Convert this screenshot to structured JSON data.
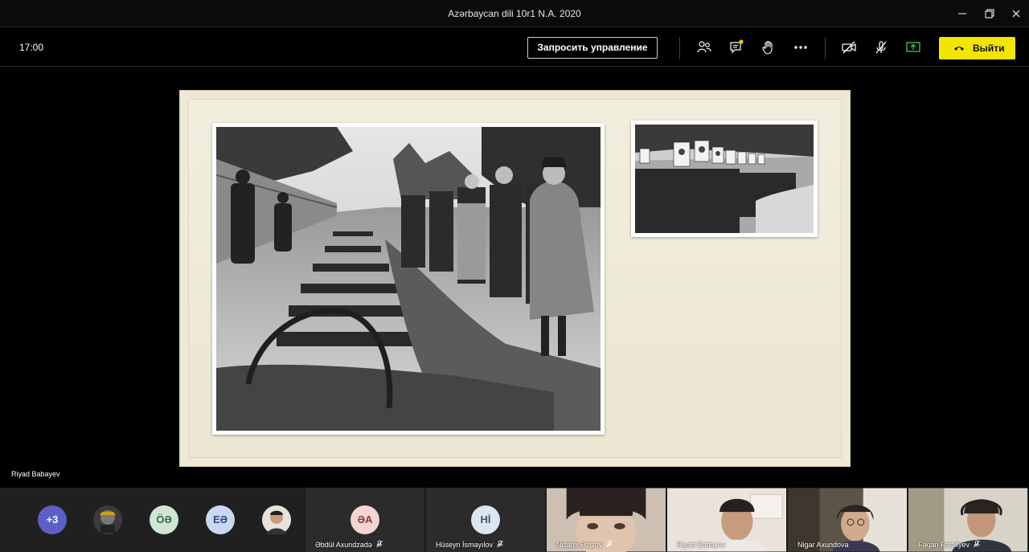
{
  "window": {
    "title": "Azərbaycan dili 10r1 N.A. 2020"
  },
  "toolbar": {
    "time": "17:00",
    "request_control_label": "Запросить управление",
    "leave_label": "Выйти",
    "icons": [
      "participants-icon",
      "chat-icon",
      "raise-hand-icon",
      "more-icon",
      "camera-off-icon",
      "mic-off-icon",
      "share-tray-icon"
    ]
  },
  "stage": {
    "presenter_name": "Riyad Babayev"
  },
  "roster": {
    "more_count": "+3",
    "avatars": [
      {
        "initials": "ÖƏ",
        "color": "#cfe6d4",
        "text_color": "#2e6b45"
      },
      {
        "initials": "EƏ",
        "color": "#c9d8f0",
        "text_color": "#2d4a82"
      }
    ]
  },
  "tiles": [
    {
      "name": "Əbdül Axundzadə",
      "initials": "ƏA",
      "avatar_color": "#f3d5d1",
      "avatar_text": "#8a3a32"
    },
    {
      "name": "Hüseyn İsmayılov",
      "initials": "Hİ",
      "avatar_color": "#dde6ee",
      "avatar_text": "#3d5672"
    },
    {
      "name": "Nizami Əzizov"
    },
    {
      "name": "Riyad Babayev"
    },
    {
      "name": "Nigar Axundova"
    },
    {
      "name": "Fəqan Fətəliyev"
    }
  ],
  "colors": {
    "leave": "#f2e600",
    "share_active": "#3cc85a",
    "notify_dot": "#f2c200"
  }
}
